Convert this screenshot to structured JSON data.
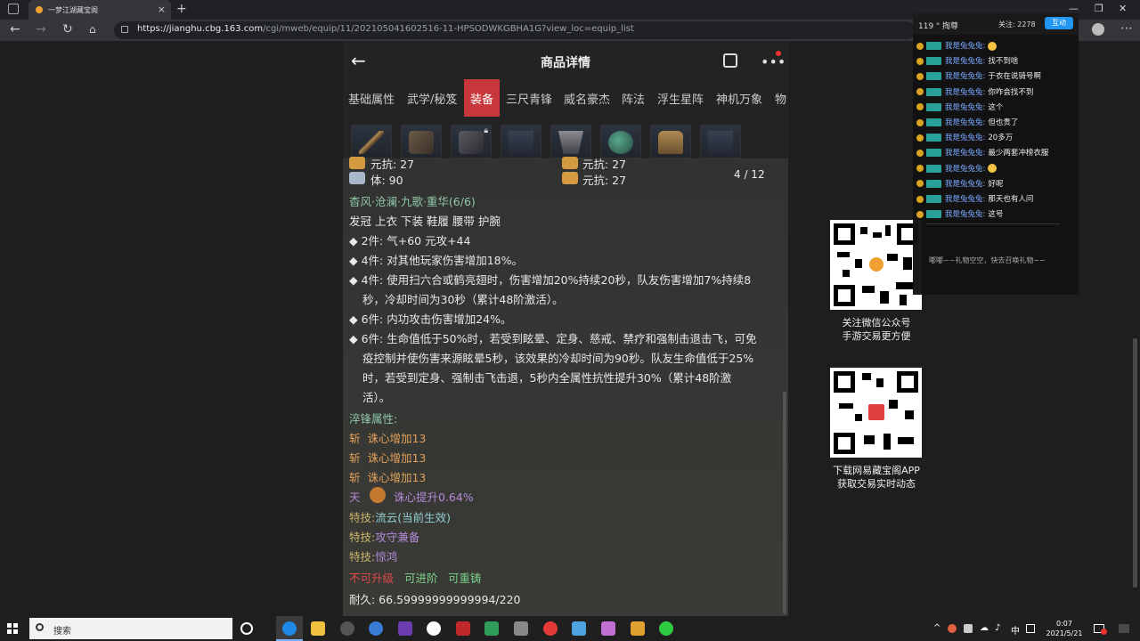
{
  "browser": {
    "tab_title": "一梦江湖藏宝阁",
    "tab_close": "×",
    "new_tab": "+",
    "url_host": "https://jianghu.cbg.163.com",
    "url_path": "/cgi/mweb/equip/11/202105041602516-11-HPSODWKGBHA1G?view_loc=equip_list"
  },
  "header": {
    "back": "←",
    "title": "商品详情",
    "more": "•••"
  },
  "tabs": [
    "基础属性",
    "武学/秘笈",
    "装备",
    "三尺青锋",
    "威名豪杰",
    "阵法",
    "浮生星阵",
    "神机万象",
    "物"
  ],
  "active_tab": "装备",
  "equip_slots": [
    "slot-1",
    "slot-2",
    "slot-3",
    "slot-4",
    "slot-5",
    "slot-6",
    "slot-7",
    "slot-8"
  ],
  "pager": "4 / 12",
  "stats": {
    "row1_left": "元抗: 27",
    "row1_right": "元抗: 27",
    "row2_left": "体: 90",
    "row2_right": "元抗: 27"
  },
  "set": {
    "name": "杳风·沧澜·九歌·重华(6/6)",
    "pieces": "发冠  上衣  下装  鞋履  腰带  护腕",
    "bonuses": [
      "◆  2件: 气+60 元攻+44",
      "◆  4件: 对其他玩家伤害增加18%。",
      "◆  4件: 使用扫六合或鹤亮翅时，伤害增加20%持续20秒，队友伤害增加7%持续8",
      "秒，冷却时间为30秒（累计48阶激活）。",
      "◆  6件: 内功攻击伤害增加24%。",
      "◆  6件: 生命值低于50%时，若受到眩晕、定身、慈戒、禁疗和强制击退击飞，可免",
      "疫控制并使伤害来源眩晕5秒，该效果的冷却时间为90秒。队友生命值低于25%",
      "时，若受到定身、强制击飞击退，5秒内全属性抗性提升30%（累计48阶激",
      "活）。"
    ]
  },
  "temper": {
    "title": "淬锋属性:",
    "lines": [
      {
        "prefix": "斩",
        "text": "诛心增加13"
      },
      {
        "prefix": "斩",
        "text": "诛心增加13"
      },
      {
        "prefix": "斩",
        "text": "诛心增加13"
      }
    ],
    "tian_prefix": "天",
    "tian_text": "诛心提升0.64%"
  },
  "skills": [
    {
      "label": "特技:",
      "value": "流云(当前生效)",
      "color": "#90d0d0"
    },
    {
      "label": "特技:",
      "value": "攻守兼备",
      "color": "#b38ad8"
    },
    {
      "label": "特技:",
      "value": "惊鸿",
      "color": "#b38ad8"
    }
  ],
  "flags": {
    "not_upgradable": "不可升级",
    "advanceable": "可进阶",
    "recastable": "可重铸"
  },
  "durability": "耐久: 66.59999999999994/220",
  "qr1": {
    "line1": "关注微信公众号",
    "line2": "手游交易更方便"
  },
  "qr2": {
    "line1": "下载网易藏宝阁APP",
    "line2": "获取交易实时动态"
  },
  "chat": {
    "viewers": "119 \" 掏尊",
    "follow": "关注: 2278",
    "button": "互动",
    "messages": [
      {
        "name": "我是兔兔兔:",
        "msg": "",
        "emoji": true
      },
      {
        "name": "我是兔兔兔:",
        "msg": "找不到啥",
        "emoji": false
      },
      {
        "name": "我是兔兔兔:",
        "msg": "于衣在说骑号啊",
        "emoji": false
      },
      {
        "name": "我是兔兔兔:",
        "msg": "你咋会找不到",
        "emoji": false
      },
      {
        "name": "我是兔兔兔:",
        "msg": "这个",
        "emoji": false
      },
      {
        "name": "我是兔兔兔:",
        "msg": "但也贵了",
        "emoji": false
      },
      {
        "name": "我是兔兔兔:",
        "msg": "20多万",
        "emoji": false
      },
      {
        "name": "我是兔兔兔:",
        "msg": "最少两套冲榜衣服",
        "emoji": false
      },
      {
        "name": "我是兔兔兔:",
        "msg": "",
        "emoji": true
      },
      {
        "name": "我是兔兔兔:",
        "msg": "好呢",
        "emoji": false
      },
      {
        "name": "我是兔兔兔:",
        "msg": "那天也有人问",
        "emoji": false
      },
      {
        "name": "我是兔兔兔:",
        "msg": "这号",
        "emoji": false
      }
    ],
    "empty_gift": "嘟嘟~~礼物空空，快去召唤礼物~~"
  },
  "taskbar": {
    "search_placeholder": "搜索",
    "time": "0:07",
    "date": "2021/5/21",
    "ime": "中"
  }
}
